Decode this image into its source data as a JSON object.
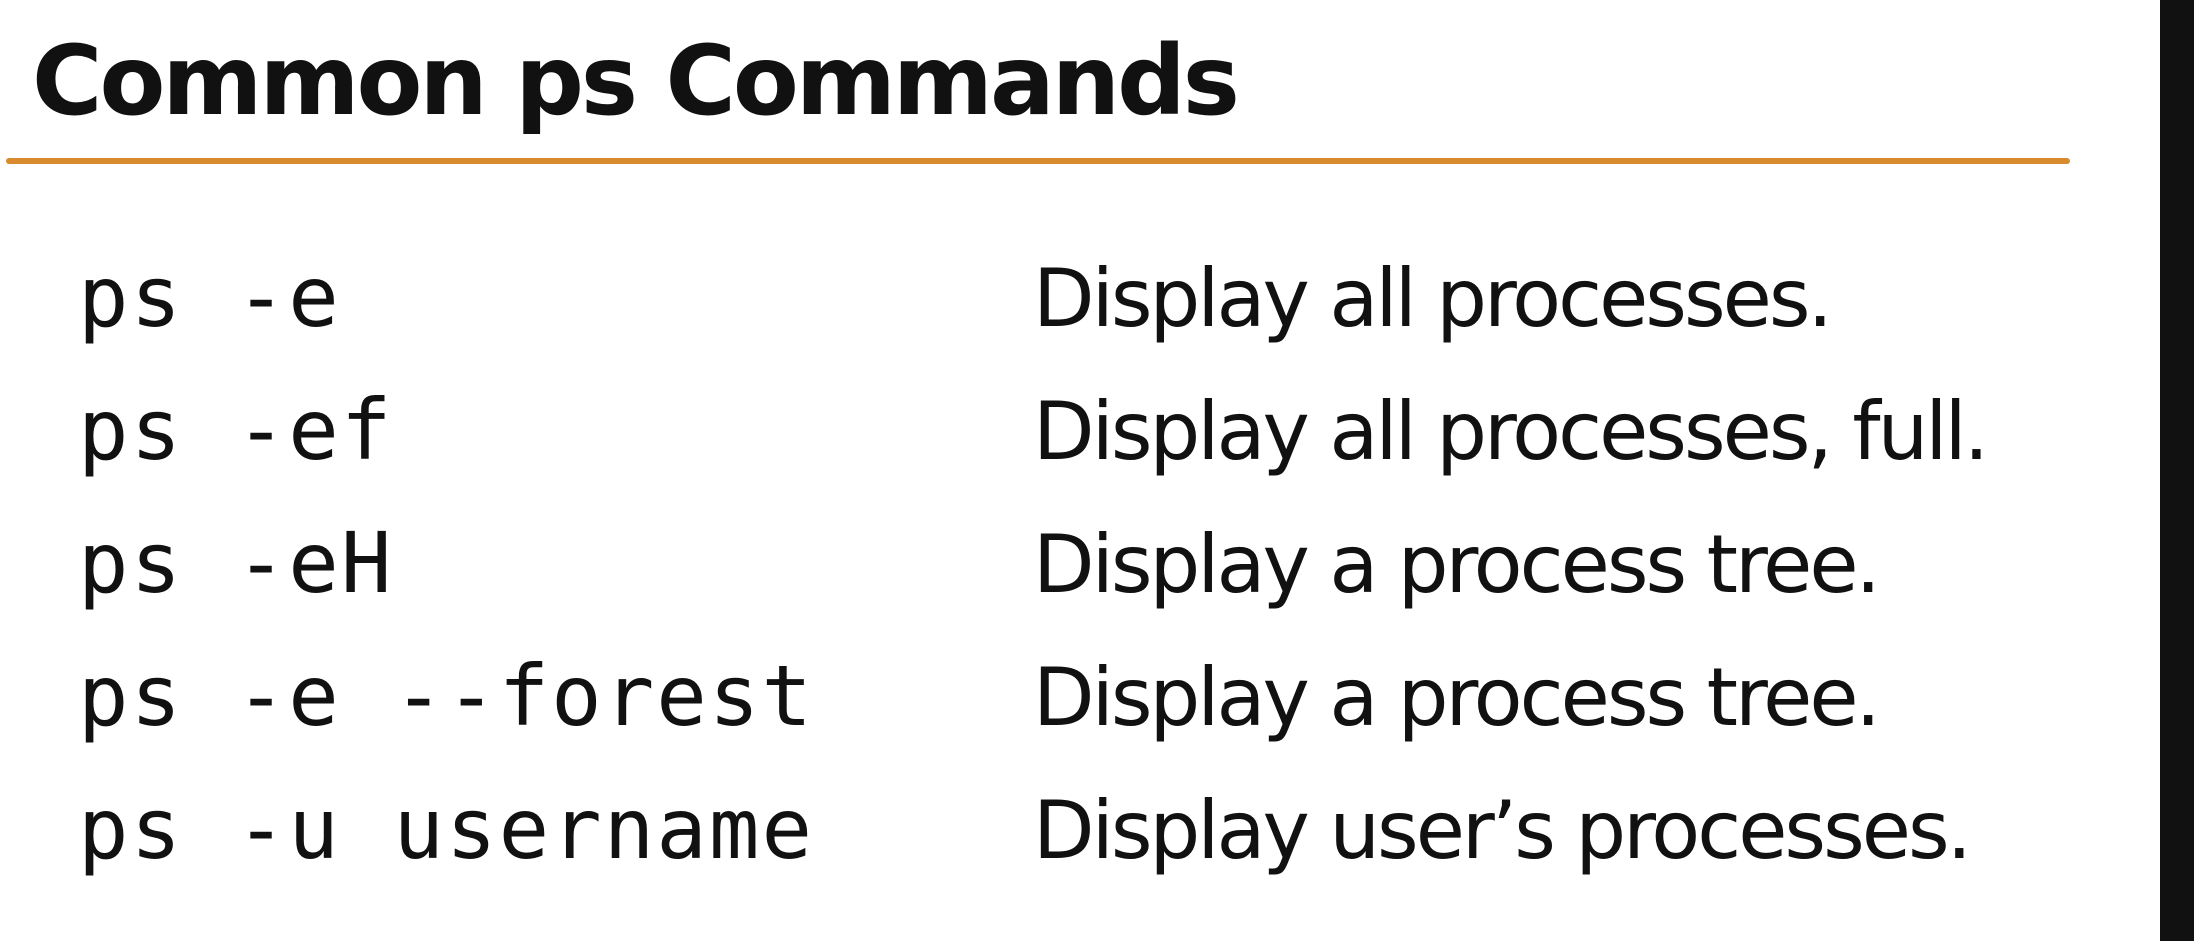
{
  "title": "Common ps Commands",
  "accent_color": "#d88a2e",
  "commands": [
    {
      "command": "ps -e",
      "description": "Display all processes."
    },
    {
      "command": "ps -ef",
      "description": "Display all processes, full."
    },
    {
      "command": "ps -eH",
      "description": "Display a process tree."
    },
    {
      "command": "ps -e --forest",
      "description": "Display a process tree."
    },
    {
      "command": "ps -u username",
      "description": "Display user’s processes."
    }
  ]
}
